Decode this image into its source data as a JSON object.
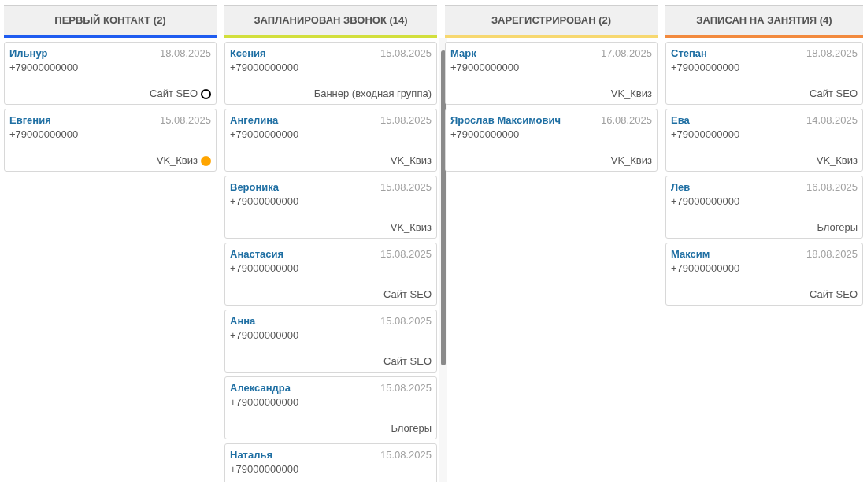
{
  "columns": [
    {
      "title": "ПЕРВЫЙ КОНТАКТ (2)",
      "color": "#1f5cf0",
      "scrollbar": false,
      "cards": [
        {
          "name": "Ильнур",
          "date": "18.08.2025",
          "phone": "+79000000000",
          "source": "Сайт SEO",
          "marker": {
            "kind": "ring",
            "color": "#000000"
          }
        },
        {
          "name": "Евгения",
          "date": "15.08.2025",
          "phone": "+79000000000",
          "source": "VK_Квиз",
          "marker": {
            "kind": "dot",
            "color": "#ffa500"
          }
        }
      ]
    },
    {
      "title": "ЗАПЛАНИРОВАН ЗВОНОК (14)",
      "color": "#d2df3c",
      "scrollbar": true,
      "cards": [
        {
          "name": "Ксения",
          "date": "15.08.2025",
          "phone": "+79000000000",
          "source": "Баннер (входная группа)"
        },
        {
          "name": "Ангелина",
          "date": "15.08.2025",
          "phone": "+79000000000",
          "source": "VK_Квиз"
        },
        {
          "name": "Вероника",
          "date": "15.08.2025",
          "phone": "+79000000000",
          "source": "VK_Квиз"
        },
        {
          "name": "Анастасия",
          "date": "15.08.2025",
          "phone": "+79000000000",
          "source": "Сайт SEO"
        },
        {
          "name": "Анна",
          "date": "15.08.2025",
          "phone": "+79000000000",
          "source": "Сайт SEO"
        },
        {
          "name": "Александра",
          "date": "15.08.2025",
          "phone": "+79000000000",
          "source": "Блогеры"
        },
        {
          "name": "Наталья",
          "date": "15.08.2025",
          "phone": "+79000000000"
        }
      ]
    },
    {
      "title": "ЗАРЕГИСТРИРОВАН (2)",
      "color": "#f7d870",
      "scrollbar": false,
      "cards": [
        {
          "name": "Марк",
          "date": "17.08.2025",
          "phone": "+79000000000",
          "source": "VK_Квиз"
        },
        {
          "name": "Ярослав Максимович",
          "date": "16.08.2025",
          "phone": "+79000000000",
          "source": "VK_Квиз"
        }
      ]
    },
    {
      "title": "ЗАПИСАН НА ЗАНЯТИЯ (4)",
      "color": "#f28a3e",
      "scrollbar": false,
      "cards": [
        {
          "name": "Степан",
          "date": "18.08.2025",
          "phone": "+79000000000",
          "source": "Сайт SEO"
        },
        {
          "name": "Ева",
          "date": "14.08.2025",
          "phone": "+79000000000",
          "source": "VK_Квиз"
        },
        {
          "name": "Лев",
          "date": "16.08.2025",
          "phone": "+79000000000",
          "source": "Блогеры"
        },
        {
          "name": "Максим",
          "date": "18.08.2025",
          "phone": "+79000000000",
          "source": "Сайт SEO"
        }
      ]
    }
  ]
}
